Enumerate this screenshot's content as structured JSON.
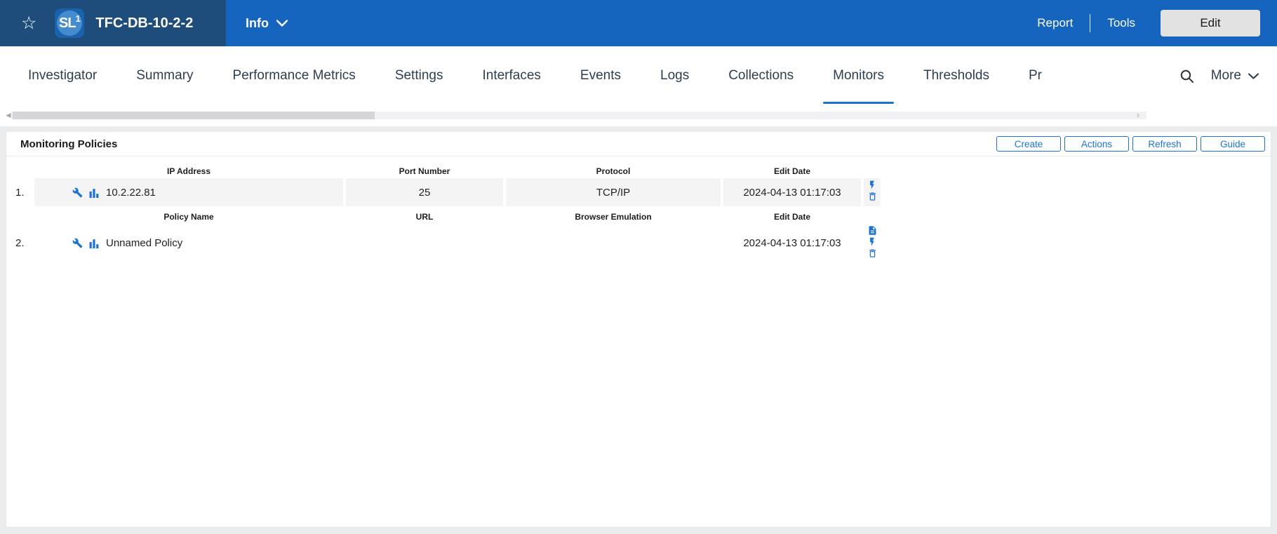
{
  "colors": {
    "header_dark": "#1e4d7c",
    "header_blue": "#1565bf",
    "accent_blue": "#1e73d2",
    "tab_text": "#2c3e50",
    "row_highlight": "#f4f4f5"
  },
  "header": {
    "logo_sl": "SL",
    "logo_one": "1",
    "device_name": "TFC-DB-10-2-2",
    "info_label": "Info",
    "report_label": "Report",
    "tools_label": "Tools",
    "edit_label": "Edit"
  },
  "tabs": {
    "items": [
      {
        "label": "Investigator",
        "active": false
      },
      {
        "label": "Summary",
        "active": false
      },
      {
        "label": "Performance Metrics",
        "active": false
      },
      {
        "label": "Settings",
        "active": false
      },
      {
        "label": "Interfaces",
        "active": false
      },
      {
        "label": "Events",
        "active": false
      },
      {
        "label": "Logs",
        "active": false
      },
      {
        "label": "Collections",
        "active": false
      },
      {
        "label": "Monitors",
        "active": true
      },
      {
        "label": "Thresholds",
        "active": false
      },
      {
        "label": "Pr",
        "active": false
      }
    ],
    "more_label": "More"
  },
  "panel": {
    "title": "Monitoring Policies",
    "buttons": [
      "Create",
      "Actions",
      "Refresh",
      "Guide"
    ]
  },
  "policies": [
    {
      "index": "1.",
      "columns": [
        "IP Address",
        "Port Number",
        "Protocol",
        "Edit Date"
      ],
      "values": [
        "10.2.22.81",
        "25",
        "TCP/IP",
        "2024-04-13 01:17:03"
      ],
      "row_icons": [
        "wrench-icon",
        "bar-chart-icon"
      ],
      "action_icons": [
        "lightning-icon",
        "trash-icon"
      ],
      "highlighted": true
    },
    {
      "index": "2.",
      "columns": [
        "Policy Name",
        "URL",
        "Browser Emulation",
        "Edit Date"
      ],
      "values": [
        "Unnamed Policy",
        "",
        "",
        "2024-04-13 01:17:03"
      ],
      "row_icons": [
        "wrench-icon",
        "bar-chart-icon"
      ],
      "action_icons": [
        "document-icon",
        "lightning-icon",
        "trash-icon"
      ],
      "highlighted": false
    }
  ]
}
